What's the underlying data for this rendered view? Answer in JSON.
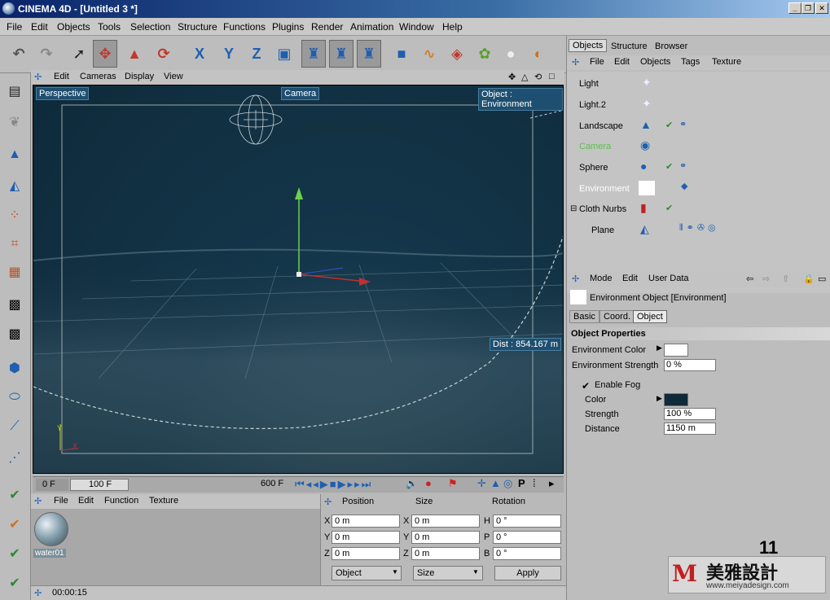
{
  "window": {
    "title": "CINEMA 4D - [Untitled 3 *]"
  },
  "menu": [
    "File",
    "Edit",
    "Objects",
    "Tools",
    "Selection",
    "Structure",
    "Functions",
    "Plugins",
    "Render",
    "Animation",
    "Window",
    "Help"
  ],
  "viewport": {
    "menu": [
      "Edit",
      "Cameras",
      "Display",
      "View"
    ],
    "label_view": "Perspective",
    "label_camera": "Camera",
    "label_object": "Object : Environment",
    "dist": "Dist : 854.167 m"
  },
  "timeline": {
    "start": "0 F",
    "current": "100 F",
    "end": "600 F"
  },
  "material_manager": {
    "menu": [
      "File",
      "Edit",
      "Function",
      "Texture"
    ],
    "material_name": "water01"
  },
  "coordinates": {
    "headers": [
      "Position",
      "Size",
      "Rotation"
    ],
    "pos": {
      "x": "0 m",
      "y": "0 m",
      "z": "0 m"
    },
    "size": {
      "x": "0 m",
      "y": "0 m",
      "z": "0 m"
    },
    "rot": {
      "h": "0 °",
      "p": "0 °",
      "b": "0 °"
    },
    "axis_labels": {
      "x": "X",
      "y": "Y",
      "z": "Z",
      "h": "H",
      "p": "P",
      "b": "B"
    },
    "mode_select": "Object",
    "size_select": "Size",
    "apply": "Apply"
  },
  "status": {
    "time": "00:00:15"
  },
  "object_manager": {
    "tabs": [
      "Objects",
      "Structure",
      "Browser"
    ],
    "menu": [
      "File",
      "Edit",
      "Objects",
      "Tags",
      "Texture"
    ],
    "objects": [
      "Light",
      "Light.2",
      "Landscape",
      "Camera",
      "Sphere",
      "Environment",
      "Cloth Nurbs",
      "Plane"
    ]
  },
  "attribute_manager": {
    "menu": [
      "Mode",
      "Edit",
      "User Data"
    ],
    "object_title": "Environment Object [Environment]",
    "tabs": [
      "Basic",
      "Coord.",
      "Object"
    ],
    "section": "Object Properties",
    "env_color_label": "Environment Color",
    "env_color": "#ffffff",
    "env_strength_label": "Environment Strength",
    "env_strength": "0 %",
    "enable_fog_label": "Enable Fog",
    "color_label": "Color",
    "fog_color": "#0f2a3a",
    "strength_label": "Strength",
    "strength": "100 %",
    "distance_label": "Distance",
    "distance": "1150 m"
  },
  "watermark": {
    "page_num": "11",
    "brand": "美雅設計",
    "url": "www.meiyadesign.com"
  },
  "icons": [
    "undo-icon",
    "redo-icon",
    "move-icon",
    "scale-icon",
    "rotate-icon",
    "x-axis-icon",
    "y-axis-icon",
    "z-axis-icon",
    "world-icon",
    "render-icon",
    "cube-icon",
    "spline-icon",
    "nurbs-icon",
    "array-icon",
    "light-icon",
    "deformer-icon"
  ]
}
